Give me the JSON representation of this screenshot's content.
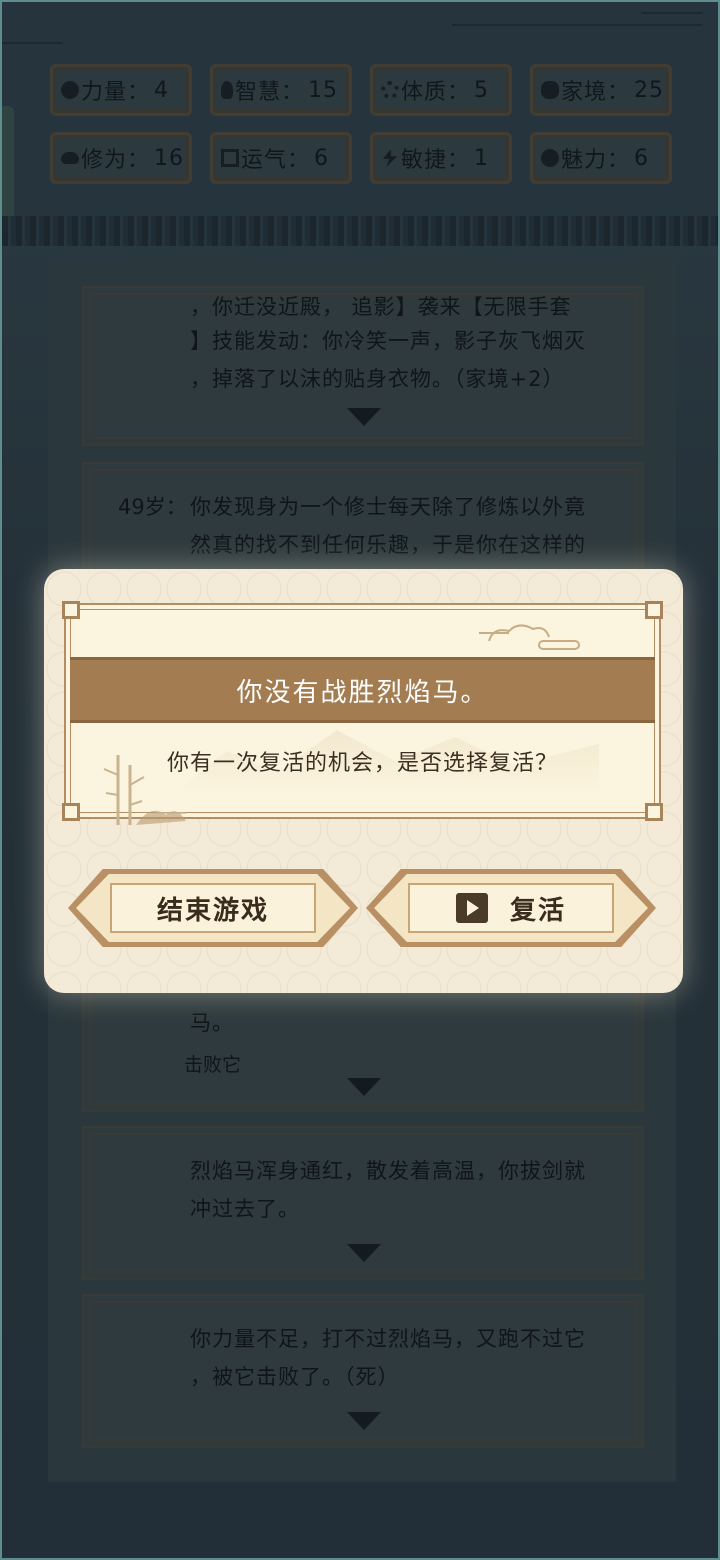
{
  "stats": [
    {
      "icon": "strength-icon",
      "label": "力量：",
      "value": "4"
    },
    {
      "icon": "wisdom-icon",
      "label": "智慧：",
      "value": "15"
    },
    {
      "icon": "constitution-icon",
      "label": "体质：",
      "value": "5"
    },
    {
      "icon": "family-icon",
      "label": "家境：",
      "value": "25"
    },
    {
      "icon": "cultivation-icon",
      "label": "修为：",
      "value": "16"
    },
    {
      "icon": "luck-icon",
      "label": "运气：",
      "value": "6"
    },
    {
      "icon": "agility-icon",
      "label": "敏捷：",
      "value": "1"
    },
    {
      "icon": "charm-icon",
      "label": "魅力：",
      "value": "6"
    }
  ],
  "log": {
    "entries": [
      {
        "age": "",
        "lines": [
          "，你迁没近殿，   追影】袭来【无限手套",
          "】技能发动：你冷笑一声，影子灰飞烟灭",
          "，掉落了以沫的贴身衣物。（家境+2）"
        ]
      },
      {
        "age": "49岁：",
        "lines": [
          "你发现身为一个修士每天除了修炼以外竟",
          "然真的找不到任何乐趣，于是你在这样的"
        ]
      },
      {
        "age": "",
        "lines": [
          "马。"
        ],
        "sub": "击败它"
      },
      {
        "age": "",
        "lines": [
          "烈焰马浑身通红，散发着高温，你拔剑就",
          "冲过去了。"
        ]
      },
      {
        "age": "",
        "lines": [
          "你力量不足，打不过烈焰马，又跑不过它",
          "，被它击败了。（死）"
        ]
      }
    ]
  },
  "modal": {
    "title": "你没有战胜烈焰马。",
    "message": "你有一次复活的机会，是否选择复活？",
    "end_button": "结束游戏",
    "revive_button": "复活",
    "revive_icon": "play-video-icon"
  },
  "colors": {
    "accent": "#a37c52",
    "modal_bg": "#f3ead8",
    "background": "#2f414a"
  }
}
